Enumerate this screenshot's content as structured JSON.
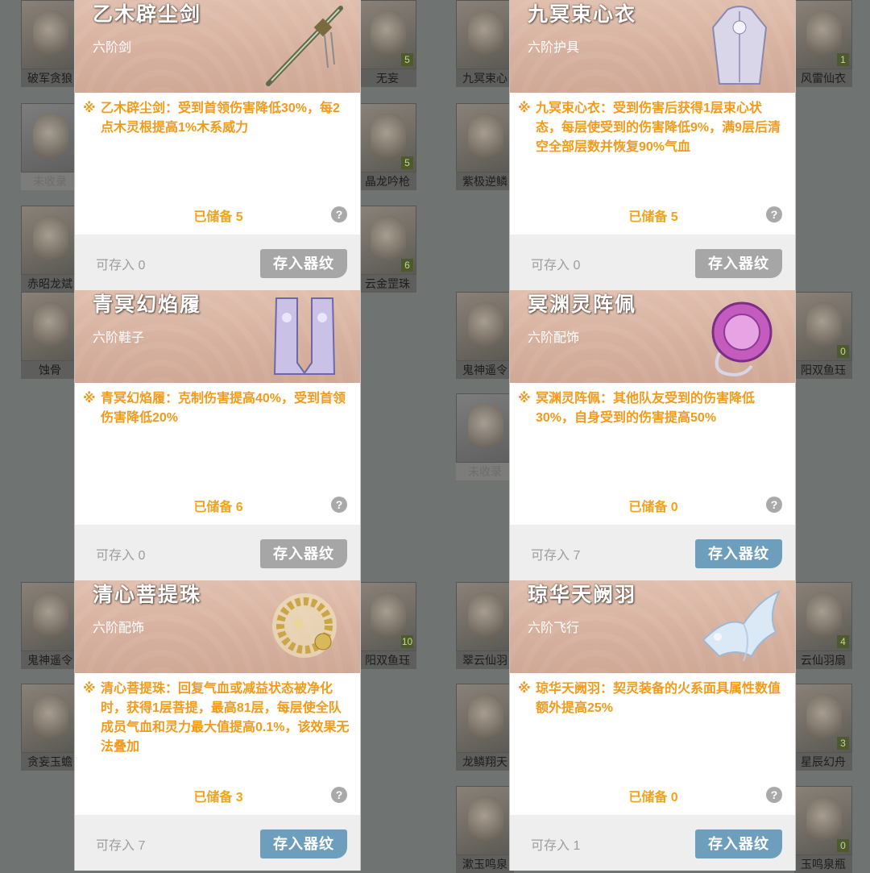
{
  "background_tiles": [
    {
      "name": "破军贪狼",
      "count": "",
      "collected": true
    },
    {
      "name": "未收录",
      "count": "",
      "collected": false
    },
    {
      "name": "赤昭龙斌",
      "count": "",
      "collected": true
    },
    {
      "name": "蚀骨",
      "count": "",
      "collected": true
    },
    {
      "name": "鬼神遥令",
      "count": "",
      "collected": true
    },
    {
      "name": "贪妄玉蟾",
      "count": "",
      "collected": true
    },
    {
      "name": "无妄",
      "count": "5",
      "collected": true
    },
    {
      "name": "晶龙吟枪",
      "count": "5",
      "collected": true
    },
    {
      "name": "云金罡珠",
      "count": "6",
      "collected": true
    },
    {
      "name": "阳双鱼珏",
      "count": "10",
      "collected": true
    },
    {
      "name": "九冥束心",
      "count": "",
      "collected": true
    },
    {
      "name": "紫极逆鳞",
      "count": "",
      "collected": true
    },
    {
      "name": "鬼神遥令",
      "count": "",
      "collected": true
    },
    {
      "name": "未收录",
      "count": "",
      "collected": false
    },
    {
      "name": "翠云仙羽",
      "count": "",
      "collected": true
    },
    {
      "name": "龙鳞翔天",
      "count": "",
      "collected": true
    },
    {
      "name": "漱玉鸣泉",
      "count": "",
      "collected": true
    },
    {
      "name": "风雷仙衣",
      "count": "1",
      "collected": true
    },
    {
      "name": "阳双鱼珏",
      "count": "0",
      "collected": true
    },
    {
      "name": "云仙羽扇",
      "count": "4",
      "collected": true
    },
    {
      "name": "星辰幻舟",
      "count": "3",
      "collected": true
    },
    {
      "name": "玉鸣泉瓶",
      "count": "0",
      "collected": true
    }
  ],
  "cards": [
    {
      "name": "乙木辟尘剑",
      "grade": "六阶剑",
      "desc": "乙木辟尘剑：受到首领伤害降低30%，每2点木灵根提高1%木系威力",
      "stored": "已储备 5",
      "available": "可存入 0",
      "button": "存入器纹",
      "art_icon": "sword-icon",
      "active": false
    },
    {
      "name": "九冥束心衣",
      "grade": "六阶护具",
      "desc": "九冥束心衣：受到伤害后获得1层束心状态，每层使受到的伤害降低9%，满9层后清空全部层数并恢复90%气血",
      "stored": "已储备 5",
      "available": "可存入 0",
      "button": "存入器纹",
      "art_icon": "robe-icon",
      "active": false
    },
    {
      "name": "青冥幻焰履",
      "grade": "六阶鞋子",
      "desc": "青冥幻焰履：克制伤害提高40%，受到首领伤害降低20%",
      "stored": "已储备 6",
      "available": "可存入 0",
      "button": "存入器纹",
      "art_icon": "boots-icon",
      "active": false
    },
    {
      "name": "冥渊灵阵佩",
      "grade": "六阶配饰",
      "desc": "冥渊灵阵佩：其他队友受到的伤害降低30%，自身受到的伤害提高50%",
      "stored": "已储备 0",
      "available": "可存入 7",
      "button": "存入器纹",
      "art_icon": "pendant-icon",
      "active": true
    },
    {
      "name": "清心菩提珠",
      "grade": "六阶配饰",
      "desc": "清心菩提珠：回复气血或减益状态被净化时，获得1层菩提，最高81层，每层使全队成员气血和灵力最大值提高0.1%，该效果无法叠加",
      "stored": "已储备 3",
      "available": "可存入 7",
      "button": "存入器纹",
      "art_icon": "beads-icon",
      "active": true
    },
    {
      "name": "琼华天阙羽",
      "grade": "六阶飞行",
      "desc": "琼华天阙羽：契灵装备的火系面具属性数值额外提高25%",
      "stored": "已储备 0",
      "available": "可存入 1",
      "button": "存入器纹",
      "art_icon": "phoenix-icon",
      "active": true
    }
  ],
  "help_glyph": "?",
  "bullet_glyph": "※"
}
